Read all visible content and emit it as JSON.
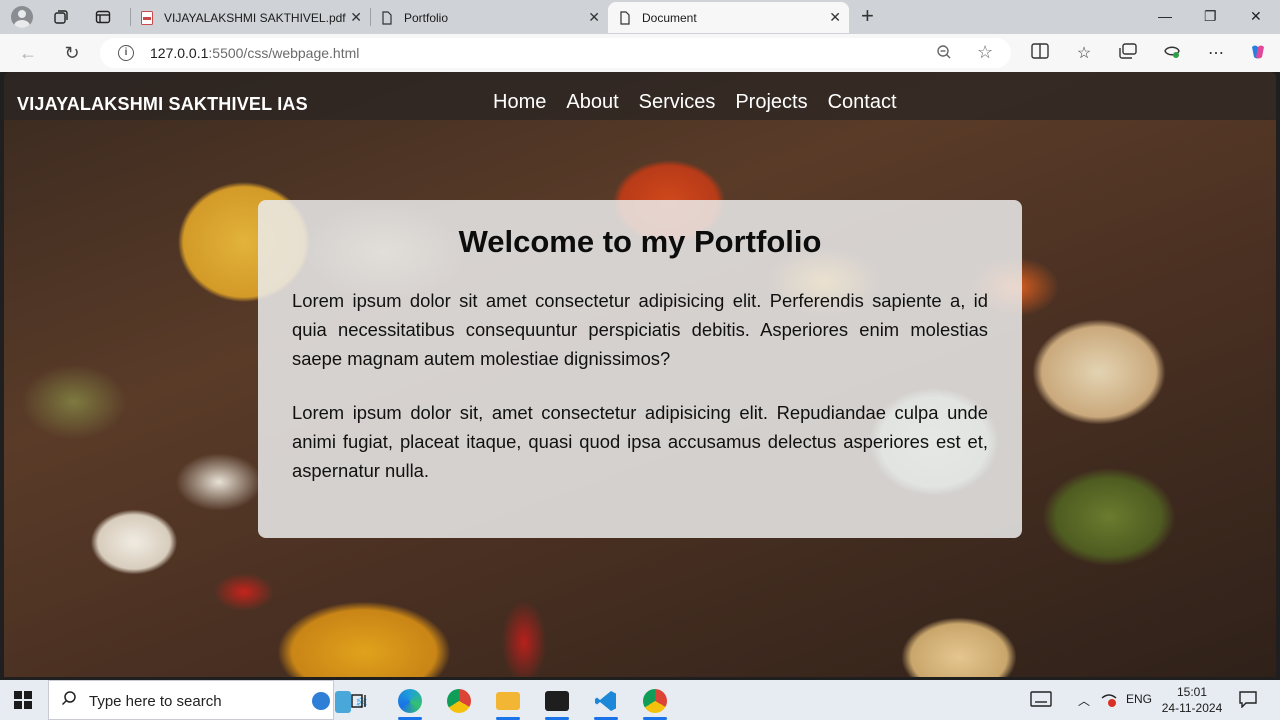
{
  "browser": {
    "tabs": [
      {
        "title": "VIJAYALAKSHMI SAKTHIVEL.pdf",
        "icon": "pdf-icon",
        "active": false
      },
      {
        "title": "Portfolio",
        "icon": "page-icon",
        "active": false
      },
      {
        "title": "Document",
        "icon": "page-icon",
        "active": true
      }
    ],
    "url_host": "127.0.0.1",
    "url_path": ":5500/css/webpage.html"
  },
  "page": {
    "brand": "VIJAYALAKSHMI SAKTHIVEL IAS",
    "nav": [
      "Home",
      "About",
      "Services",
      "Projects",
      "Contact"
    ],
    "heading": "Welcome to my Portfolio",
    "paragraphs": [
      "Lorem ipsum dolor sit amet consectetur adipisicing elit. Perferendis sapiente a, id quia necessitatibus consequuntur perspiciatis debitis. Asperiores enim molestias saepe magnam autem molestiae dignissimos?",
      "Lorem ipsum dolor sit, amet consectetur adipisicing elit. Repudiandae culpa unde animi fugiat, placeat itaque, quasi quod ipsa accusamus delectus asperiores est et, aspernatur nulla."
    ]
  },
  "taskbar": {
    "search_placeholder": "Type here to search",
    "language": "ENG",
    "time": "15:01",
    "date": "24-11-2024"
  },
  "colors": {
    "navbar_bg": "#282422",
    "card_bg": "#ebebeb",
    "accent": "#1a73e8"
  }
}
